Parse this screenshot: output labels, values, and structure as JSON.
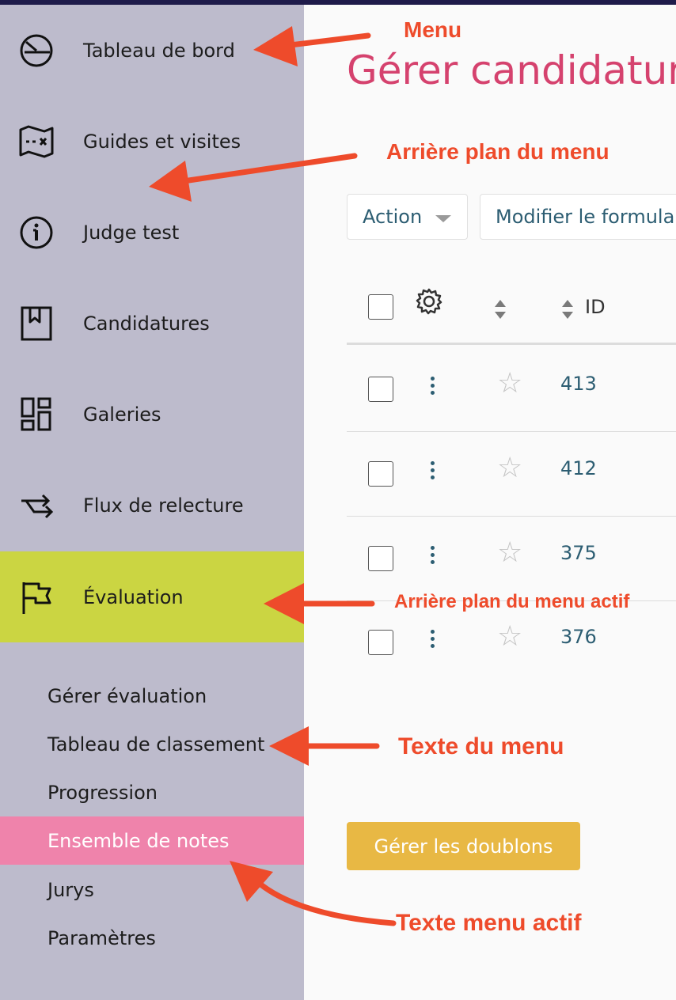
{
  "colors": {
    "topbar": "#1f1b4a",
    "sidebar_bg": "#bdbbcc",
    "active_menu_bg": "#cbd542",
    "active_sub_bg": "#ef83ab",
    "title": "#d5426e",
    "link": "#2c5d72",
    "duplicate_button": "#e8b844",
    "annotation": "#ee4b2b"
  },
  "sidebar": {
    "menu": [
      {
        "label": "Tableau de bord",
        "icon": "dashboard-gauge-icon"
      },
      {
        "label": "Guides et visites",
        "icon": "map-icon"
      },
      {
        "label": "Judge test",
        "icon": "info-icon"
      },
      {
        "label": "Candidatures",
        "icon": "bookmark-icon"
      },
      {
        "label": "Galeries",
        "icon": "gallery-grid-icon"
      },
      {
        "label": "Flux de relecture",
        "icon": "workflow-arrows-icon"
      },
      {
        "label": "Évaluation",
        "icon": "flag-icon",
        "active": true
      }
    ],
    "submenu": [
      {
        "label": "Gérer évaluation"
      },
      {
        "label": "Tableau de classement"
      },
      {
        "label": "Progression"
      },
      {
        "label": "Ensemble de notes",
        "active": true
      },
      {
        "label": "Jurys"
      },
      {
        "label": "Paramètres"
      }
    ]
  },
  "main": {
    "title": "Gérer candidatures",
    "action_button": "Action",
    "form_button": "Modifier le formulaire",
    "table": {
      "id_header": "ID",
      "rows": [
        {
          "id": "413"
        },
        {
          "id": "412"
        },
        {
          "id": "375"
        },
        {
          "id": "376"
        }
      ]
    },
    "duplicates_button": "Gérer les doublons"
  },
  "annotations": {
    "menu": "Menu",
    "menu_background": "Arrière plan du menu",
    "active_menu_background": "Arrière plan du menu actif",
    "menu_text": "Texte du menu",
    "active_menu_text": "Texte menu actif"
  }
}
